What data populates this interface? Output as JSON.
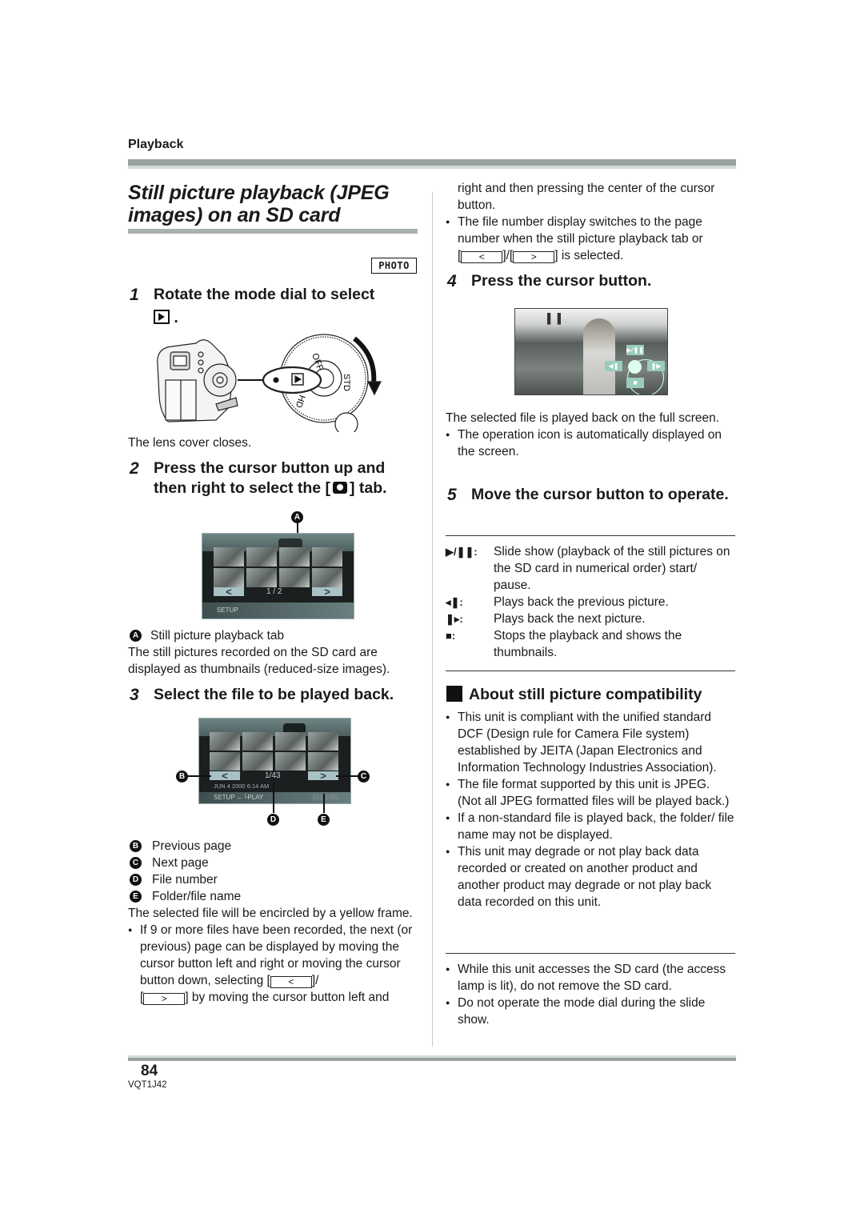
{
  "header": {
    "section": "Playback",
    "title": "Still picture playback (JPEG images) on an SD card",
    "mode_badge": "PHOTO"
  },
  "left": {
    "step1": {
      "num": "1",
      "text": "Rotate the mode dial to select",
      "icon_suffix": "."
    },
    "dial_labels": {
      "off": "OFF",
      "std": "STD",
      "hd": "HD"
    },
    "lens_note": "The lens cover closes.",
    "step2": {
      "num": "2",
      "text_a": "Press the cursor button up and",
      "text_b_pre": "then right to select the [",
      "text_b_post": "] tab."
    },
    "screen1": {
      "page": "1 / 2",
      "footer": "SETUP",
      "prev": "<",
      "next": ">",
      "label_a": "A"
    },
    "legend_a": {
      "letter": "A",
      "text": "Still picture playback tab"
    },
    "para_thumbs": "The still pictures recorded on the SD card are displayed as thumbnails (reduced-size images).",
    "step3": {
      "num": "3",
      "text": "Select the file to be played back."
    },
    "screen2": {
      "page": "1/43",
      "date": "JUN  4 2000   6:14 AM",
      "footer": "SETUP  ←└PLAY",
      "folder": "101-1001",
      "prev": "<",
      "next": ">",
      "label_b": "B",
      "label_c": "C",
      "label_d": "D",
      "label_e": "E"
    },
    "legend": [
      {
        "letter": "B",
        "text": "Previous page"
      },
      {
        "letter": "C",
        "text": "Next page"
      },
      {
        "letter": "D",
        "text": "File number"
      },
      {
        "letter": "E",
        "text": "Folder/file name"
      }
    ],
    "para_yellow": "The selected file will be encircled by a yellow frame.",
    "bullet_pages_a": "If 9 or more files have been recorded, the next (or previous) page can be displayed by moving the cursor button left and right or moving the cursor button down, selecting [",
    "bullet_pages_b": "]/",
    "bullet_pages_c": "[",
    "bullet_pages_d": "] by moving the cursor button left and",
    "btn_prev": "<",
    "btn_next": ">"
  },
  "right": {
    "cont_text": "right and then pressing the center of the cursor button.",
    "bullet_file_a": "The file number display switches to the page number when the still picture playback tab or",
    "bullet_file_b": "[",
    "bullet_file_c": "]/[",
    "bullet_file_d": "] is selected.",
    "btn_prev": "<",
    "btn_next": ">",
    "step4": {
      "num": "4",
      "text": "Press the cursor button."
    },
    "screen3": {
      "pause_icon": "▌▐",
      "play_pause": "▶/❚❚",
      "prev": "◀❚",
      "next": "❚▶",
      "stop": "■"
    },
    "para_full": "The selected file is played back on the full screen.",
    "bullet_icon": "The operation icon is automatically displayed on the screen.",
    "step5": {
      "num": "5",
      "text": "Move the cursor button to operate."
    },
    "operations": [
      {
        "symbol": "▶/❚❚:",
        "text": "Slide show (playback of the still pictures on the SD card in numerical order) start/ pause."
      },
      {
        "symbol": "◂❚:",
        "text": "Plays back the previous picture."
      },
      {
        "symbol": "❚▸:",
        "text": "Plays back the next picture."
      },
      {
        "symbol": "■:",
        "text": "Stops the playback and shows the thumbnails."
      }
    ],
    "compat_heading": "About still picture compatibility",
    "compat_bullets": [
      "This unit is compliant with the unified standard DCF (Design rule for Camera File system) established by JEITA (Japan Electronics and Information Technology Industries Association).",
      "The file format supported by this unit is JPEG. (Not all JPEG formatted files will be played back.)",
      "If a non-standard file is played back, the folder/ file name may not be displayed.",
      "This unit may degrade or not play back data recorded or created on another product and another product may degrade or not play back data recorded on this unit."
    ],
    "notes": [
      "While this unit accesses the SD card (the access lamp is lit), do not remove the SD card.",
      "Do not operate the mode dial during the slide show."
    ]
  },
  "footer": {
    "page_number": "84",
    "doc_id": "VQT1J42"
  }
}
